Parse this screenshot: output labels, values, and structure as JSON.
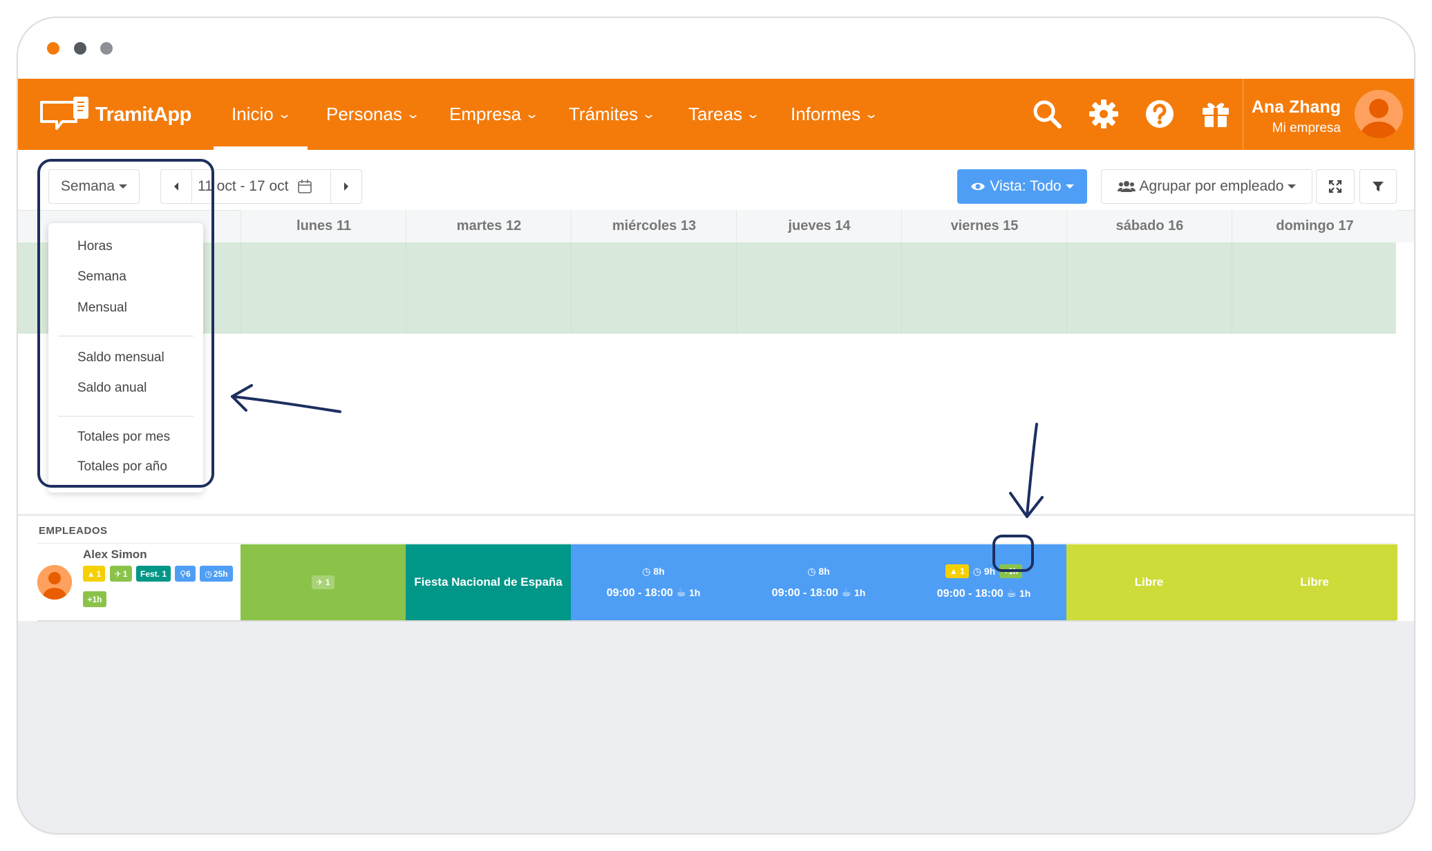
{
  "app": {
    "logo_text": "TramitApp"
  },
  "nav": {
    "items": [
      {
        "label": "Inicio"
      },
      {
        "label": "Personas"
      },
      {
        "label": "Empresa"
      },
      {
        "label": "Trámites"
      },
      {
        "label": "Tareas"
      },
      {
        "label": "Informes"
      }
    ],
    "icons": [
      "search-icon",
      "settings-icon",
      "help-icon",
      "gift-icon"
    ]
  },
  "user": {
    "name": "Ana Zhang",
    "company": "Mi empresa"
  },
  "toolbar": {
    "view_select": "Semana",
    "date_range": "11 oct - 17 oct",
    "view_button": "Vista: Todo",
    "group_button": "Agrupar por empleado"
  },
  "dropdown": {
    "items": [
      "Horas",
      "Semana",
      "Mensual",
      "Saldo mensual",
      "Saldo anual",
      "Totales por mes",
      "Totales por año"
    ]
  },
  "days": [
    "lunes 11",
    "martes 12",
    "miércoles 13",
    "jueves 14",
    "viernes 15",
    "sábado 16",
    "domingo 17"
  ],
  "employees_label": "EMPLEADOS",
  "employee": {
    "name": "Alex Simon",
    "badges": [
      "1",
      "1",
      "Fest. 1",
      "6",
      "25h",
      "+1h"
    ]
  },
  "schedule": {
    "monday": "1",
    "tuesday": "Fiesta Nacional de España",
    "wednesday": {
      "hours": "8h",
      "time": "09:00 - 18:00",
      "break": "1h"
    },
    "thursday": {
      "hours": "8h",
      "time": "09:00 - 18:00",
      "break": "1h"
    },
    "friday": {
      "warning": "1",
      "hours": "9h",
      "extra": "+1h",
      "time": "09:00 - 18:00",
      "break": "1h"
    },
    "saturday": "Libre",
    "sunday": "Libre"
  },
  "colors": {
    "brand": "#f47b0a",
    "primary": "#4f9ef5",
    "vacation": "#8bc34a",
    "holiday": "#009688",
    "shift": "#4f9ef5",
    "free": "#cddc39",
    "annotation": "#1d2f5f"
  }
}
